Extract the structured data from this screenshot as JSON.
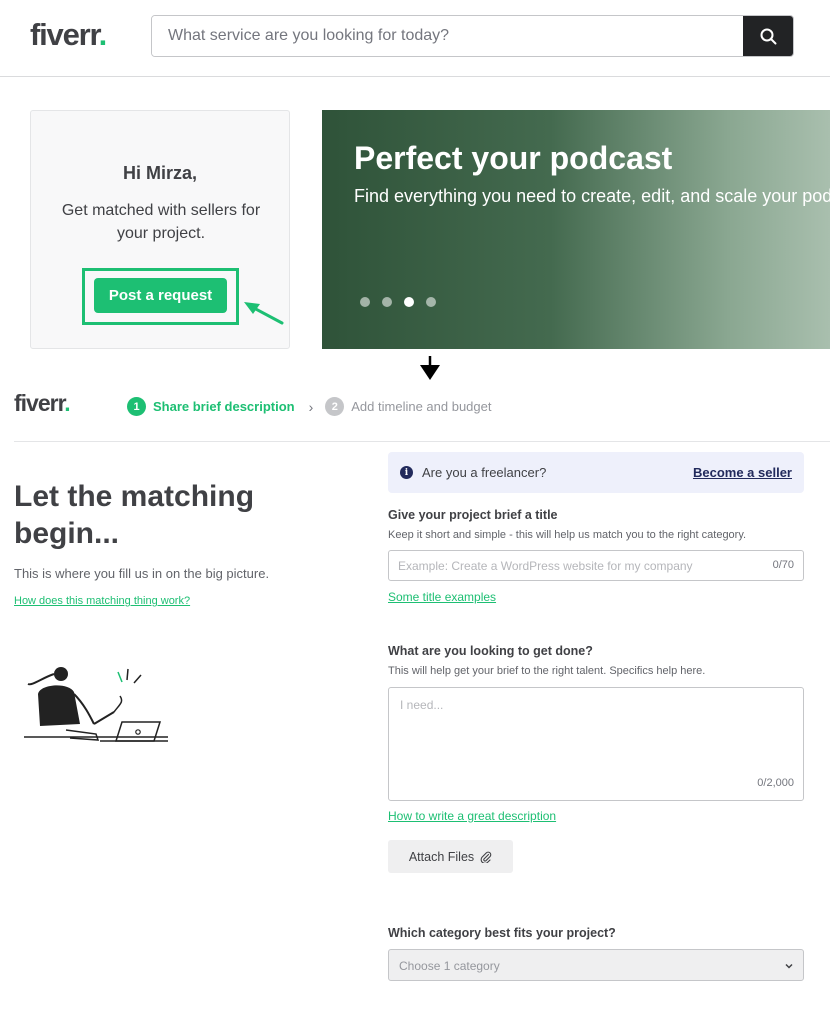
{
  "header": {
    "logo_text": "fiverr",
    "logo_dot": ".",
    "search_placeholder": "What service are you looking for today?",
    "search_icon": "search-icon"
  },
  "welcome": {
    "greeting": "Hi Mirza,",
    "message": "Get matched with sellers for your project.",
    "post_button": "Post a request"
  },
  "banner": {
    "title": "Perfect your podcast",
    "subtitle": "Find everything you need to create, edit, and scale your podcast",
    "active_slide": 3,
    "slide_count": 4
  },
  "brief": {
    "logo_text": "fiverr",
    "logo_dot": ".",
    "steps": [
      {
        "number": "1",
        "label": "Share brief description",
        "active": true
      },
      {
        "number": "2",
        "label": "Add timeline and budget",
        "active": false
      }
    ],
    "heading": "Let the matching begin...",
    "intro": "This is where you fill us in on the big picture.",
    "how_link": "How does this matching thing work?",
    "freelancer_question": "Are you a freelancer?",
    "become_seller_link": "Become a seller",
    "title_field": {
      "label": "Give your project brief a title",
      "help": "Keep it short and simple - this will help us match you to the right category.",
      "placeholder": "Example: Create a WordPress website for my company",
      "counter": "0/70",
      "examples_link": "Some title examples"
    },
    "description_field": {
      "label": "What are you looking to get done?",
      "help": "This will help get your brief to the right talent. Specifics help here.",
      "placeholder": "I need...",
      "counter": "0/2,000",
      "guide_link": "How to write a great description"
    },
    "attach_button": "Attach Files",
    "category_field": {
      "label": "Which category best fits your project?",
      "value": "Choose 1 category"
    }
  },
  "colors": {
    "brand_green": "#1dbf73",
    "text_dark": "#404145",
    "navy": "#222a5c"
  }
}
